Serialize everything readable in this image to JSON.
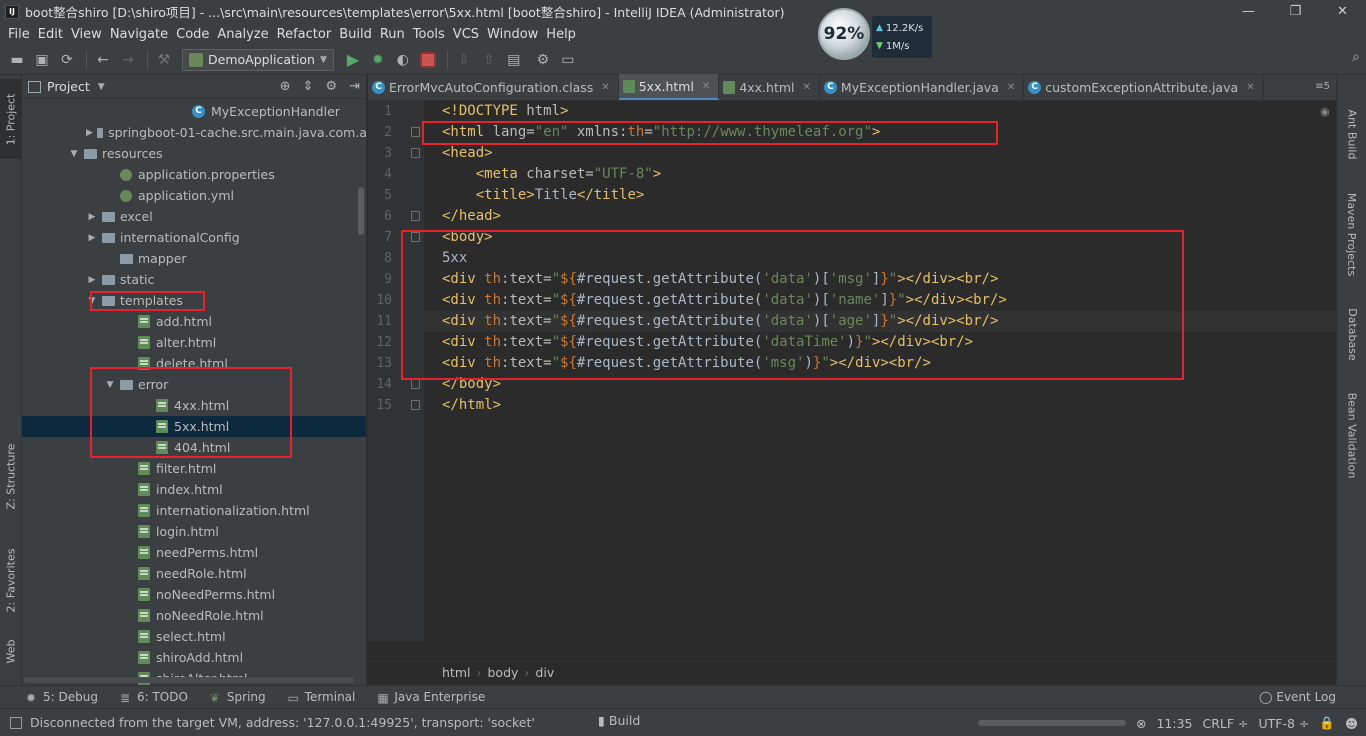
{
  "window": {
    "title": "boot整合shiro [D:\\shiro项目] - ...\\src\\main\\resources\\templates\\error\\5xx.html [boot整合shiro] - IntelliJ IDEA (Administrator)",
    "logo": "IJ",
    "controls": [
      "—",
      "❐",
      "✕"
    ]
  },
  "net_widget": {
    "percent": "92%",
    "upload": "12.2K/s",
    "download": "1M/s"
  },
  "menu": [
    "File",
    "Edit",
    "View",
    "Navigate",
    "Code",
    "Analyze",
    "Refactor",
    "Build",
    "Run",
    "Tools",
    "VCS",
    "Window",
    "Help"
  ],
  "toolbar": {
    "run_config": "DemoApplication"
  },
  "left_strip": {
    "project_tab": "1: Project",
    "structure_tab": "Z: Structure",
    "favorites_tab": "2: Favorites",
    "web_tab": "Web"
  },
  "right_strip": [
    "Ant Build",
    "Maven Projects",
    "Database",
    "Bean Validation"
  ],
  "project_panel": {
    "title": "Project",
    "tree": [
      {
        "label": "MyExceptionHandler",
        "type": "class",
        "indent": 9,
        "arrow": ""
      },
      {
        "label": "springboot-01-cache.src.main.java.com.a",
        "type": "folder",
        "indent": 4,
        "arrow": "▶"
      },
      {
        "label": "resources",
        "type": "folder",
        "indent": 3,
        "arrow": "▼"
      },
      {
        "label": "application.properties",
        "type": "props",
        "indent": 5,
        "arrow": ""
      },
      {
        "label": "application.yml",
        "type": "props",
        "indent": 5,
        "arrow": ""
      },
      {
        "label": "excel",
        "type": "folder",
        "indent": 4,
        "arrow": "▶"
      },
      {
        "label": "internationalConfig",
        "type": "folder",
        "indent": 4,
        "arrow": "▶"
      },
      {
        "label": "mapper",
        "type": "folder",
        "indent": 5,
        "arrow": ""
      },
      {
        "label": "static",
        "type": "folder",
        "indent": 4,
        "arrow": "▶"
      },
      {
        "label": "templates",
        "type": "folder",
        "indent": 4,
        "arrow": "▼"
      },
      {
        "label": "add.html",
        "type": "html",
        "indent": 6,
        "arrow": ""
      },
      {
        "label": "alter.html",
        "type": "html",
        "indent": 6,
        "arrow": ""
      },
      {
        "label": "delete.html",
        "type": "html",
        "indent": 6,
        "arrow": ""
      },
      {
        "label": "error",
        "type": "folder",
        "indent": 5,
        "arrow": "▼"
      },
      {
        "label": "4xx.html",
        "type": "html",
        "indent": 7,
        "arrow": ""
      },
      {
        "label": "5xx.html",
        "type": "html",
        "indent": 7,
        "arrow": "",
        "selected": true
      },
      {
        "label": "404.html",
        "type": "html",
        "indent": 7,
        "arrow": ""
      },
      {
        "label": "filter.html",
        "type": "html",
        "indent": 6,
        "arrow": ""
      },
      {
        "label": "index.html",
        "type": "html",
        "indent": 6,
        "arrow": ""
      },
      {
        "label": "internationalization.html",
        "type": "html",
        "indent": 6,
        "arrow": ""
      },
      {
        "label": "login.html",
        "type": "html",
        "indent": 6,
        "arrow": ""
      },
      {
        "label": "needPerms.html",
        "type": "html",
        "indent": 6,
        "arrow": ""
      },
      {
        "label": "needRole.html",
        "type": "html",
        "indent": 6,
        "arrow": ""
      },
      {
        "label": "noNeedPerms.html",
        "type": "html",
        "indent": 6,
        "arrow": ""
      },
      {
        "label": "noNeedRole.html",
        "type": "html",
        "indent": 6,
        "arrow": ""
      },
      {
        "label": "select.html",
        "type": "html",
        "indent": 6,
        "arrow": ""
      },
      {
        "label": "shiroAdd.html",
        "type": "html",
        "indent": 6,
        "arrow": ""
      },
      {
        "label": "shiroAlter.html",
        "type": "html",
        "indent": 6,
        "arrow": ""
      }
    ]
  },
  "editor": {
    "tabs": [
      {
        "label": "ErrorMvcAutoConfiguration.class",
        "icon": "class",
        "active": false
      },
      {
        "label": "5xx.html",
        "icon": "html",
        "active": true
      },
      {
        "label": "4xx.html",
        "icon": "html",
        "active": false
      },
      {
        "label": "MyExceptionHandler.java",
        "icon": "class",
        "active": false
      },
      {
        "label": "customExceptionAttribute.java",
        "icon": "class",
        "active": false
      }
    ],
    "tab_overflow": "≡5",
    "lines": [
      {
        "n": "1",
        "tokens": [
          [
            "tag",
            "<!DOCTYPE "
          ],
          [
            "attr",
            "html"
          ],
          [
            "tag",
            ">"
          ]
        ]
      },
      {
        "n": "2",
        "tokens": [
          [
            "tag",
            "<html "
          ],
          [
            "attr",
            "lang="
          ],
          [
            "str",
            "\"en\""
          ],
          [
            "attr",
            " xmlns:"
          ],
          [
            "brace",
            "th"
          ],
          [
            "attr",
            "="
          ],
          [
            "str",
            "\"http://www.thymeleaf.org\""
          ],
          [
            "tag",
            ">"
          ]
        ],
        "fold": true
      },
      {
        "n": "3",
        "tokens": [
          [
            "tag",
            "<head>"
          ]
        ],
        "fold": true
      },
      {
        "n": "4",
        "tokens": [
          [
            "plain",
            "    "
          ],
          [
            "tag",
            "<meta "
          ],
          [
            "attr",
            "charset="
          ],
          [
            "str",
            "\"UTF-8\""
          ],
          [
            "tag",
            ">"
          ]
        ]
      },
      {
        "n": "5",
        "tokens": [
          [
            "plain",
            "    "
          ],
          [
            "tag",
            "<title>"
          ],
          [
            "plain",
            "Title"
          ],
          [
            "tag",
            "</title>"
          ]
        ]
      },
      {
        "n": "6",
        "tokens": [
          [
            "tag",
            "</head>"
          ]
        ],
        "fold": true
      },
      {
        "n": "7",
        "tokens": [
          [
            "tag",
            "<body>"
          ]
        ],
        "fold": true
      },
      {
        "n": "8",
        "tokens": [
          [
            "plain",
            "5xx"
          ]
        ]
      },
      {
        "n": "9",
        "tokens": [
          [
            "tag",
            "<div "
          ],
          [
            "brace",
            "th"
          ],
          [
            "attr",
            ":text="
          ],
          [
            "str",
            "\""
          ],
          [
            "brace",
            "${"
          ],
          [
            "plain",
            "#request.getAttribute("
          ],
          [
            "str",
            "'data'"
          ],
          [
            "plain",
            ")["
          ],
          [
            "str",
            "'msg'"
          ],
          [
            "plain",
            "]"
          ],
          [
            "brace",
            "}"
          ],
          [
            "str",
            "\""
          ],
          [
            "tag",
            "></div><br/>"
          ]
        ]
      },
      {
        "n": "10",
        "tokens": [
          [
            "tag",
            "<div "
          ],
          [
            "brace",
            "th"
          ],
          [
            "attr",
            ":text="
          ],
          [
            "str",
            "\""
          ],
          [
            "brace",
            "${"
          ],
          [
            "plain",
            "#request.getAttribute("
          ],
          [
            "str",
            "'data'"
          ],
          [
            "plain",
            ")["
          ],
          [
            "str",
            "'name'"
          ],
          [
            "plain",
            "]"
          ],
          [
            "brace",
            "}"
          ],
          [
            "str",
            "\""
          ],
          [
            "tag",
            "></div><br/>"
          ]
        ]
      },
      {
        "n": "11",
        "tokens": [
          [
            "tag",
            "<div "
          ],
          [
            "brace",
            "th"
          ],
          [
            "attr",
            ":text="
          ],
          [
            "str",
            "\""
          ],
          [
            "brace",
            "${"
          ],
          [
            "plain",
            "#request.getAttribute("
          ],
          [
            "str",
            "'data'"
          ],
          [
            "plain",
            ")["
          ],
          [
            "str",
            "'age'"
          ],
          [
            "plain",
            "]"
          ],
          [
            "brace",
            "}"
          ],
          [
            "str",
            "\""
          ],
          [
            "tag",
            "></div><br/>"
          ]
        ],
        "current": true
      },
      {
        "n": "12",
        "tokens": [
          [
            "tag",
            "<div "
          ],
          [
            "brace",
            "th"
          ],
          [
            "attr",
            ":text="
          ],
          [
            "str",
            "\""
          ],
          [
            "brace",
            "${"
          ],
          [
            "plain",
            "#request.getAttribute("
          ],
          [
            "str",
            "'dataTime'"
          ],
          [
            "plain",
            ")"
          ],
          [
            "brace",
            "}"
          ],
          [
            "str",
            "\""
          ],
          [
            "tag",
            "></div><br/>"
          ]
        ]
      },
      {
        "n": "13",
        "tokens": [
          [
            "tag",
            "<div "
          ],
          [
            "brace",
            "th"
          ],
          [
            "attr",
            ":text="
          ],
          [
            "str",
            "\""
          ],
          [
            "brace",
            "${"
          ],
          [
            "plain",
            "#request.getAttribute("
          ],
          [
            "str",
            "'msg'"
          ],
          [
            "plain",
            ")"
          ],
          [
            "brace",
            "}"
          ],
          [
            "str",
            "\""
          ],
          [
            "tag",
            "></div><br/>"
          ]
        ]
      },
      {
        "n": "14",
        "tokens": [
          [
            "tag",
            "</body>"
          ]
        ],
        "fold": true
      },
      {
        "n": "15",
        "tokens": [
          [
            "tag",
            "</html>"
          ]
        ],
        "fold": true
      }
    ],
    "breadcrumb": [
      "html",
      "body",
      "div"
    ]
  },
  "bottom_tools": [
    "5: Debug",
    "6: TODO",
    "Spring",
    "Terminal",
    "Java Enterprise"
  ],
  "event_log": "Event Log",
  "status": {
    "message": "Disconnected from the target VM, address: '127.0.0.1:49925', transport: 'socket'",
    "build": "Build",
    "time": "11:35",
    "line_sep": "CRLF ÷",
    "encoding": "UTF-8 ÷"
  },
  "colors": {
    "highlight_box": "#e8212e",
    "selection": "#0d293e",
    "accent_tab": "#4a88c7"
  }
}
